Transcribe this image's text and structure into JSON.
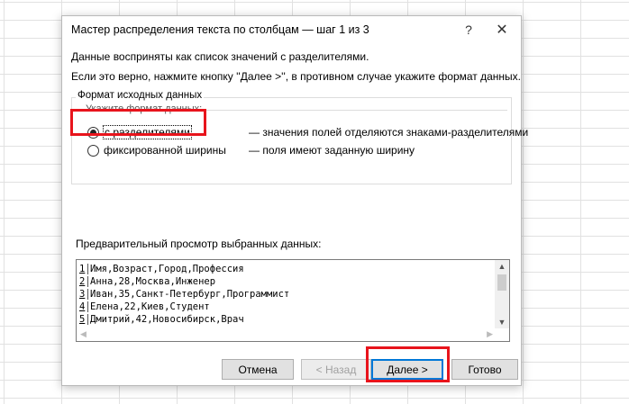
{
  "dialog": {
    "title": "Мастер распределения текста по столбцам — шаг 1 из 3",
    "help_label": "?",
    "close_label": "✕"
  },
  "intro": {
    "line1": "Данные восприняты как список значений с разделителями.",
    "line2": "Если это верно, нажмите кнопку ''Далее >'', в противном случае укажите формат данных."
  },
  "format_group": {
    "legend": "Формат исходных данных",
    "sub_legend": "Укажите формат данных:",
    "options": [
      {
        "label": "с разделителями",
        "description": "— значения полей отделяются знаками-разделителями",
        "selected": true
      },
      {
        "label": "фиксированной ширины",
        "description": "— поля имеют заданную ширину",
        "selected": false
      }
    ]
  },
  "preview": {
    "label": "Предварительный просмотр выбранных данных:",
    "rows": [
      {
        "num": "1",
        "text": "Имя,Возраст,Город,Профессия"
      },
      {
        "num": "2",
        "text": "Анна,28,Москва,Инженер"
      },
      {
        "num": "3",
        "text": "Иван,35,Санкт-Петербург,Программист"
      },
      {
        "num": "4",
        "text": "Елена,22,Киев,Студент"
      },
      {
        "num": "5",
        "text": "Дмитрий,42,Новосибирск,Врач"
      }
    ]
  },
  "buttons": {
    "cancel": "Отмена",
    "back": "< Назад",
    "next": "Далее >",
    "finish": "Готово"
  },
  "colors": {
    "highlight": "#e8141c",
    "focus": "#0078d7"
  }
}
